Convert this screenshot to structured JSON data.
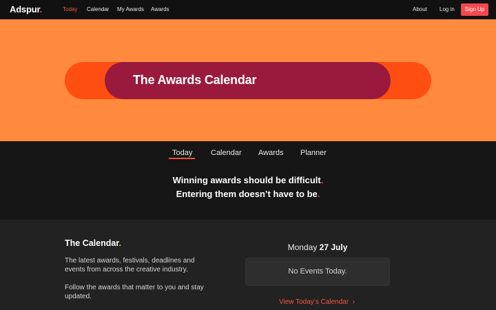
{
  "header": {
    "logo": "Adspur",
    "logo_dot": ".",
    "nav": [
      "Today",
      "Calendar",
      "My Awards",
      "Awards"
    ],
    "right": {
      "about": "About",
      "login": "Log in",
      "signup": "Sign Up"
    }
  },
  "hero": {
    "title": "The Awards Calendar"
  },
  "tabs": [
    "Today",
    "Calendar",
    "Awards",
    "Planner"
  ],
  "tagline": {
    "line1": "Winning awards should be difficult",
    "line2": "Entering them doesn’t have to be",
    "punct": "."
  },
  "calendar": {
    "title": "The Calendar",
    "title_dot": ".",
    "para1": "The latest awards, festivals, deadlines and events from across the creative industry.",
    "para2": "Follow the awards that matter to you and stay updated.",
    "day": "Monday",
    "date": "27 July",
    "no_events": "No Events Today.",
    "view_link": "View Today’s Calendar",
    "view_chevron": "›"
  },
  "colors": {
    "accent": "#f04a3c",
    "hero_bg": "#ff8a3d",
    "pill_outer": "#ff4e12",
    "pill_inner": "#9a1a3d",
    "signup_bg": "#f04a4f"
  }
}
